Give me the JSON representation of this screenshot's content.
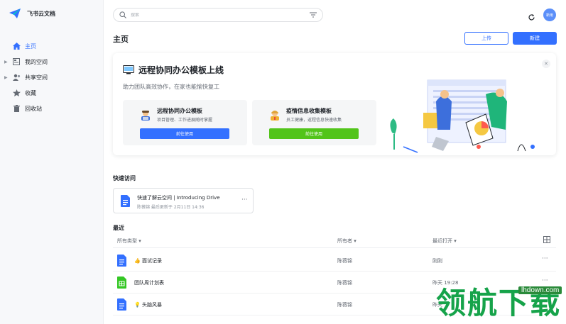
{
  "app": {
    "name": "飞书云文档"
  },
  "sidebar": {
    "items": [
      {
        "label": "主页",
        "icon": "home-icon"
      },
      {
        "label": "我的空间",
        "icon": "folder-icon"
      },
      {
        "label": "共享空间",
        "icon": "users-icon"
      },
      {
        "label": "收藏",
        "icon": "star-icon"
      },
      {
        "label": "回收站",
        "icon": "trash-icon"
      }
    ]
  },
  "header": {
    "search_placeholder": "搜索",
    "avatar_text": "新用",
    "page_title": "主页",
    "upload_label": "上传",
    "new_label": "新建"
  },
  "banner": {
    "title": "远程协同办公模板上线",
    "subtitle": "助力团队高效协作，在家也能愉快复工",
    "cards": [
      {
        "title": "远程协同办公模板",
        "desc": "项目管理、工作进展随时掌握",
        "button": "前往使用",
        "button_color": "#3370ff"
      },
      {
        "title": "疫情信息收集模板",
        "desc": "员工健康，返程信息快速收集",
        "button": "前往使用",
        "button_color": "#52c41a"
      }
    ]
  },
  "quick_access": {
    "title": "快速访问",
    "item": {
      "name": "快速了解云空间 | Introducing Drive",
      "meta": "陈薇锦 最后更新于 2月11日 14:36"
    }
  },
  "recent": {
    "title": "最近",
    "columns": {
      "type": "所有类型 ▾",
      "owner": "所有者 ▾",
      "opened": "最近打开 ▾"
    },
    "rows": [
      {
        "name": "👍 面试记录",
        "owner": "陈薇锦",
        "opened": "刚刚",
        "icon": "doc-icon"
      },
      {
        "name": "团队周计划表",
        "owner": "陈薇锦",
        "opened": "昨天 19:28",
        "icon": "sheet-icon"
      },
      {
        "name": "💡 头脑风暴",
        "owner": "陈薇锦",
        "opened": "昨天",
        "icon": "doc-icon"
      }
    ]
  },
  "watermark": {
    "text": "领航下载",
    "url": "lhdown.com"
  },
  "colors": {
    "accent": "#3370ff",
    "green": "#52c41a",
    "sheet": "#34c724"
  }
}
